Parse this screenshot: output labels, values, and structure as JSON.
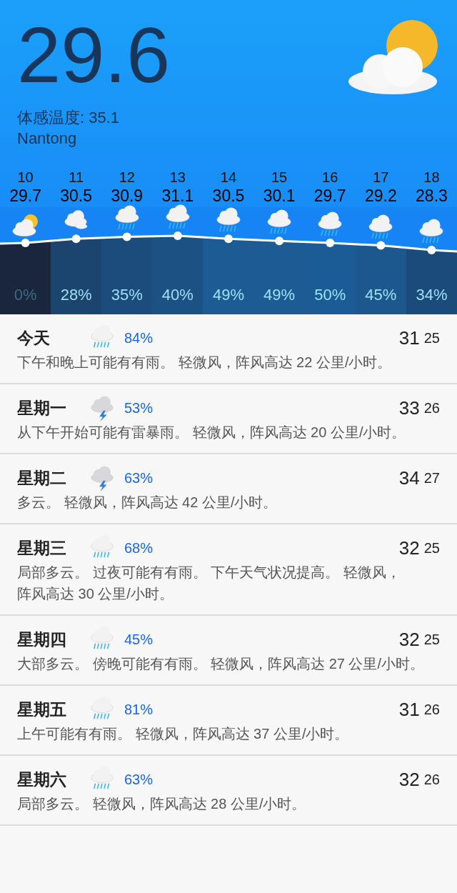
{
  "current": {
    "temperature": "29.6",
    "feels_like": "体感温度: 35.1",
    "city": "Nantong",
    "kind": "partly-sunny"
  },
  "hourly": [
    {
      "hour": "10",
      "temp": "29.7",
      "kind": "partly-sunny",
      "precip": "0%"
    },
    {
      "hour": "11",
      "temp": "30.5",
      "kind": "cloudy",
      "precip": "28%"
    },
    {
      "hour": "12",
      "temp": "30.9",
      "kind": "rain",
      "precip": "35%"
    },
    {
      "hour": "13",
      "temp": "31.1",
      "kind": "rain",
      "precip": "40%"
    },
    {
      "hour": "14",
      "temp": "30.5",
      "kind": "rain",
      "precip": "49%"
    },
    {
      "hour": "15",
      "temp": "30.1",
      "kind": "rain",
      "precip": "49%"
    },
    {
      "hour": "16",
      "temp": "29.7",
      "kind": "rain",
      "precip": "50%"
    },
    {
      "hour": "17",
      "temp": "29.2",
      "kind": "rain",
      "precip": "45%"
    },
    {
      "hour": "18",
      "temp": "28.3",
      "kind": "rain",
      "precip": "34%"
    }
  ],
  "daily": [
    {
      "day": "今天",
      "kind": "rain",
      "precip": "84%",
      "high": "31",
      "low": "25",
      "summary": "下午和晚上可能有有雨。 轻微风，阵风高达 22 公里/小时。"
    },
    {
      "day": "星期一",
      "kind": "thunderstorm",
      "precip": "53%",
      "high": "33",
      "low": "26",
      "summary": "从下午开始可能有雷暴雨。 轻微风，阵风高达 20 公里/小时。"
    },
    {
      "day": "星期二",
      "kind": "thunderstorm",
      "precip": "63%",
      "high": "34",
      "low": "27",
      "summary": "多云。 轻微风，阵风高达 42 公里/小时。"
    },
    {
      "day": "星期三",
      "kind": "rain",
      "precip": "68%",
      "high": "32",
      "low": "25",
      "summary": "局部多云。 过夜可能有有雨。 下午天气状况提高。 轻微风，阵风高达 30 公里/小时。"
    },
    {
      "day": "星期四",
      "kind": "rain",
      "precip": "45%",
      "high": "32",
      "low": "25",
      "summary": "大部多云。 傍晚可能有有雨。 轻微风，阵风高达 27 公里/小时。"
    },
    {
      "day": "星期五",
      "kind": "rain",
      "precip": "81%",
      "high": "31",
      "low": "26",
      "summary": "上午可能有有雨。 轻微风，阵风高达 37 公里/小时。"
    },
    {
      "day": "星期六",
      "kind": "rain",
      "precip": "63%",
      "high": "32",
      "low": "26",
      "summary": "局部多云。 轻微风，阵风高达 28 公里/小时。"
    }
  ]
}
